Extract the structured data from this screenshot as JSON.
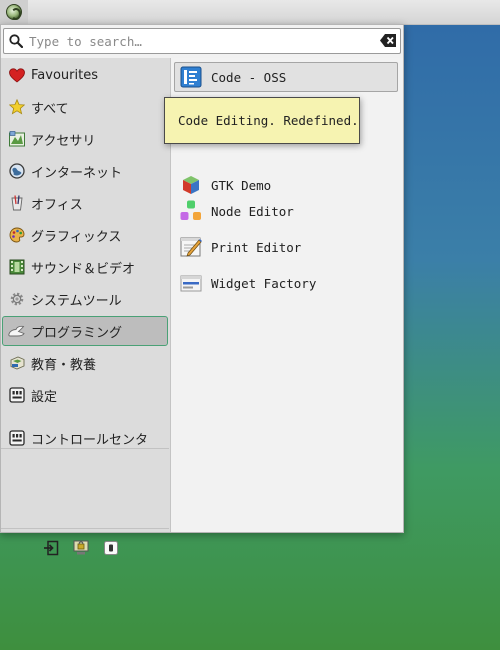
{
  "search": {
    "placeholder": "Type to search…",
    "value": ""
  },
  "categories": [
    {
      "label": "Favourites",
      "icon": "heart-icon"
    },
    {
      "label": "すべて",
      "icon": "star-icon"
    },
    {
      "label": "アクセサリ",
      "icon": "accessories-icon"
    },
    {
      "label": "インターネット",
      "icon": "globe-icon"
    },
    {
      "label": "オフィス",
      "icon": "office-icon"
    },
    {
      "label": "グラフィックス",
      "icon": "palette-icon"
    },
    {
      "label": "サウンド＆ビデオ",
      "icon": "film-icon"
    },
    {
      "label": "システムツール",
      "icon": "gear-icon"
    },
    {
      "label": "プログラミング",
      "icon": "programming-icon",
      "selected": true
    },
    {
      "label": "教育・教養",
      "icon": "education-icon"
    },
    {
      "label": "設定",
      "icon": "settings-icon"
    },
    {
      "label": "コントロールセンタ",
      "icon": "control-center-icon"
    }
  ],
  "apps": [
    {
      "label": "Code - OSS",
      "icon": "code-oss-icon",
      "hovered": true
    },
    {
      "label": "GTK Demo",
      "icon": "gtk-icon"
    },
    {
      "label": "Node Editor",
      "icon": "node-editor-icon"
    },
    {
      "label": "Print Editor",
      "icon": "print-editor-icon"
    },
    {
      "label": "Widget Factory",
      "icon": "widget-factory-icon"
    }
  ],
  "tooltip": {
    "text": "Code Editing. Redefined."
  },
  "bottom_actions": [
    {
      "icon": "logout-icon"
    },
    {
      "icon": "lock-screen-icon"
    },
    {
      "icon": "shutdown-icon"
    }
  ],
  "colors": {
    "selected_border": "#4aa176",
    "tooltip_bg": "#f6f3b1"
  }
}
